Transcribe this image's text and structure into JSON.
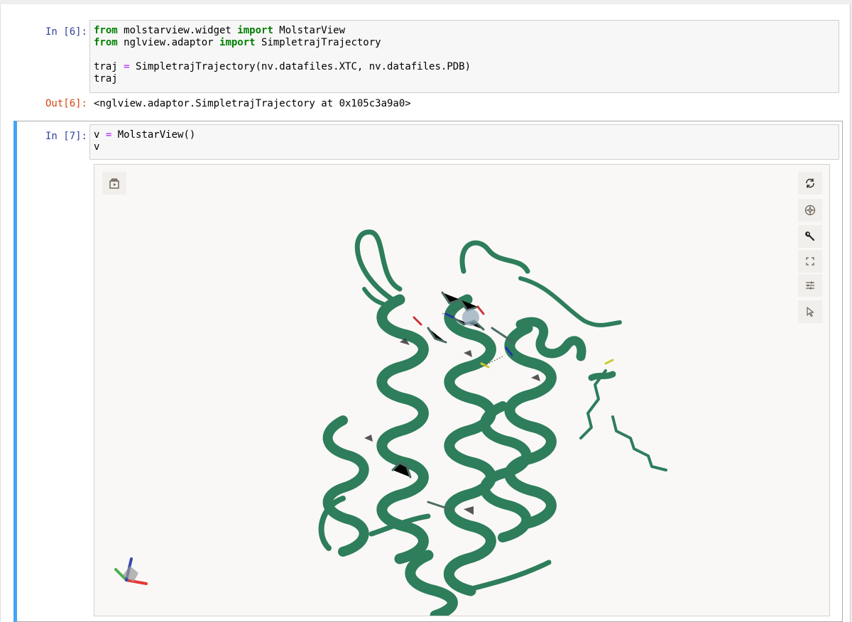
{
  "cells": [
    {
      "prompt_in": "In [6]:",
      "code_lines": [
        [
          {
            "t": "from",
            "c": "kw"
          },
          {
            "t": " molstarview.widget ",
            "c": ""
          },
          {
            "t": "import",
            "c": "kw"
          },
          {
            "t": " MolstarView",
            "c": ""
          }
        ],
        [
          {
            "t": "from",
            "c": "kw"
          },
          {
            "t": " nglview.adaptor ",
            "c": ""
          },
          {
            "t": "import",
            "c": "kw"
          },
          {
            "t": " SimpletrajTrajectory",
            "c": ""
          }
        ],
        [
          {
            "t": "",
            "c": ""
          }
        ],
        [
          {
            "t": "traj ",
            "c": ""
          },
          {
            "t": "=",
            "c": "op"
          },
          {
            "t": " SimpletrajTrajectory(nv.datafiles.XTC, nv.datafiles.PDB)",
            "c": ""
          }
        ],
        [
          {
            "t": "traj",
            "c": ""
          }
        ]
      ],
      "prompt_out": "Out[6]:",
      "output": "<nglview.adaptor.SimpletrajTrajectory at 0x105c3a9a0>"
    },
    {
      "prompt_in": "In [7]:",
      "code_lines": [
        [
          {
            "t": "v ",
            "c": ""
          },
          {
            "t": "=",
            "c": "op"
          },
          {
            "t": " MolstarView()",
            "c": ""
          }
        ],
        [
          {
            "t": "v",
            "c": ""
          }
        ]
      ]
    }
  ],
  "viewer": {
    "background": "#f9f8f7",
    "ribbon_color": "#2e7d5b",
    "toolbar_left": [
      "animation-icon"
    ],
    "toolbar_right": [
      "reset-icon",
      "screenshot-icon",
      "wrench-icon",
      "expand-icon",
      "settings-icon",
      "selection-cursor-icon"
    ]
  }
}
